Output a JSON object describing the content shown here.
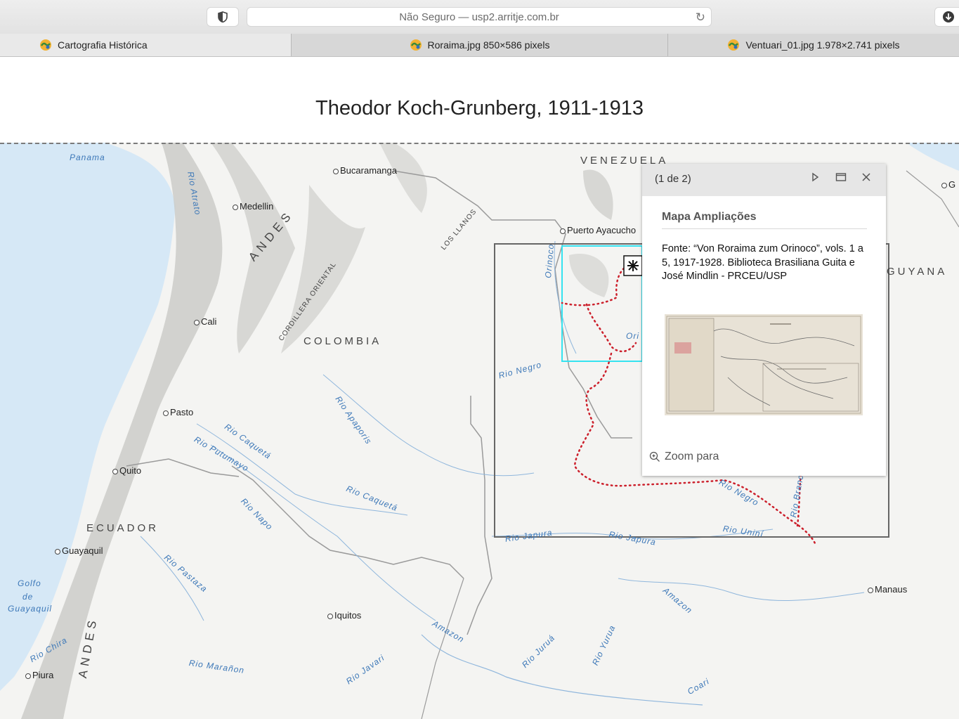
{
  "browser": {
    "url": "Não Seguro — usp2.arritje.com.br",
    "tabs": [
      {
        "label": "Cartografia Histórica"
      },
      {
        "label": "Roraima.jpg 850×586 pixels"
      },
      {
        "label": "Ventuari_01.jpg 1.978×2.741 pixels"
      }
    ]
  },
  "page": {
    "title": "Theodor Koch-Grunberg, 1911-1913"
  },
  "map": {
    "countries": [
      "VENEZUELA",
      "COLOMBIA",
      "ECUADOR",
      "GUYANA"
    ],
    "cities": [
      "Bucaramanga",
      "Medellin",
      "Puerto Ayacucho",
      "Cali",
      "Pasto",
      "Quito",
      "Guayaquil",
      "Iquitos",
      "Piura",
      "Manaus"
    ],
    "ranges": [
      "ANDES",
      "ANDES",
      "CORDILLERA ORIENTAL",
      "LOS LLANOS"
    ],
    "rivers": [
      "Panama",
      "Rio Atrato",
      "Orinoco",
      "Ori",
      "Rio Negro",
      "Rio Apaporis",
      "Rio Caquetá",
      "Rio Putumayo",
      "Rio Caquetá",
      "Rio Napo",
      "Rio Pastaza",
      "Golfo",
      "de",
      "Guayaquil",
      "Rio Chira",
      "Rio Marañon",
      "Rio Javari",
      "Amazon",
      "Rio Japura",
      "Rio Japura",
      "Rio Negro",
      "Rio Uniní",
      "Rio Branco",
      "Amazon",
      "Rio Juruá",
      "Rio Yurua",
      "Coari"
    ],
    "edge": [
      "G"
    ]
  },
  "popup": {
    "count": "(1 de 2)",
    "title": "Mapa Ampliações",
    "body": "Fonte: “Von Roraima zum Orinoco”, vols. 1 a 5, 1917-1928. Biblioteca Brasiliana Guita e José Mindlin - PRCEU/USP",
    "zoom_label": "Zoom para"
  },
  "colors": {
    "route": "#cc1f2b",
    "highlight": "#35e3f0",
    "water": "#d6e8f6",
    "river_label": "#3d78b8"
  }
}
